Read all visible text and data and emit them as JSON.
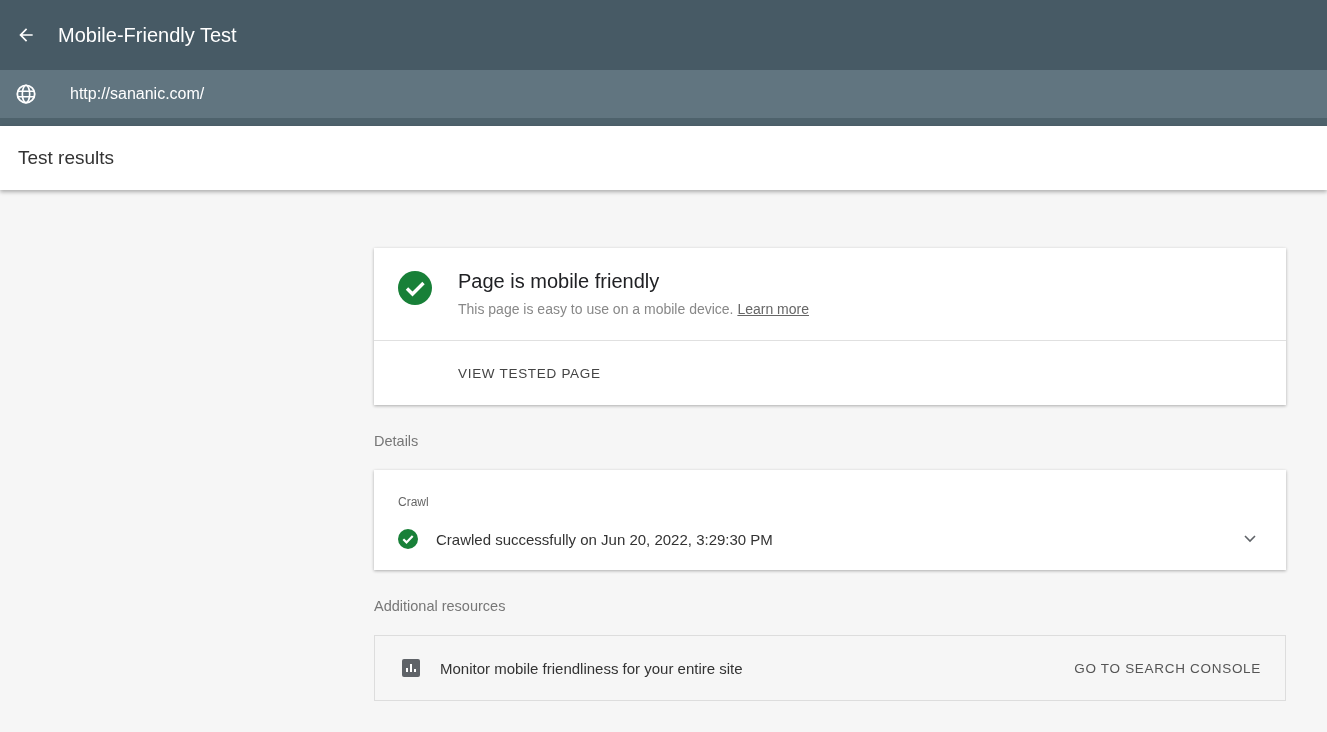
{
  "app_bar": {
    "title": "Mobile-Friendly Test"
  },
  "url_bar": {
    "url": "http://sananic.com/"
  },
  "page_header": {
    "title": "Test results"
  },
  "result_card": {
    "title": "Page is mobile friendly",
    "description": "This page is easy to use on a mobile device.",
    "link": "Learn more",
    "action": "VIEW TESTED PAGE"
  },
  "details": {
    "heading": "Details",
    "section": "Crawl",
    "status": "Crawled successfully on Jun 20, 2022, 3:29:30 PM",
    "expanded": false
  },
  "additional_resources": {
    "heading": "Additional resources",
    "text": "Monitor mobile friendliness for your entire site",
    "action": "GO TO SEARCH CONSOLE"
  }
}
